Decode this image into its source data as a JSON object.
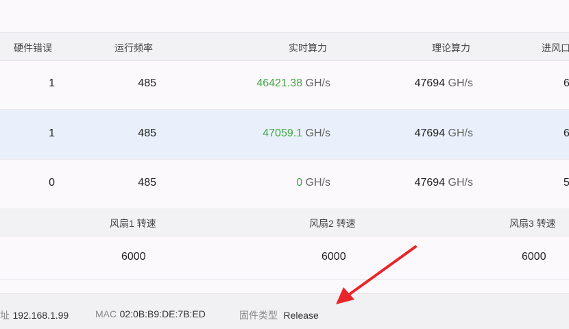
{
  "hash_table": {
    "headers": {
      "hw_errors": "硬件错误",
      "frequency": "运行频率",
      "realtime_hashrate": "实时算力",
      "theoretical_hashrate": "理论算力",
      "inlet": "进风口"
    },
    "rows": [
      {
        "hw_errors": "1",
        "frequency": "485",
        "realtime_value": "46421.38",
        "realtime_unit": "GH/s",
        "theoretical_value": "47694",
        "theoretical_unit": "GH/s",
        "inlet": "6"
      },
      {
        "hw_errors": "1",
        "frequency": "485",
        "realtime_value": "47059.1",
        "realtime_unit": "GH/s",
        "theoretical_value": "47694",
        "theoretical_unit": "GH/s",
        "inlet": "6"
      },
      {
        "hw_errors": "0",
        "frequency": "485",
        "realtime_value": "0",
        "realtime_unit": "GH/s",
        "theoretical_value": "47694",
        "theoretical_unit": "GH/s",
        "inlet": "5"
      }
    ]
  },
  "fan_table": {
    "headers": {
      "fan1": "风扇1 转速",
      "fan2": "风扇2 转速",
      "fan3": "风扇3 转速"
    },
    "values": {
      "fan1": "6000",
      "fan2": "6000",
      "fan3": "6000"
    }
  },
  "footer": {
    "ip_label": "址",
    "ip_value": "192.168.1.99",
    "mac_label": "MAC",
    "mac_value": "02:0B:B9:DE:7B:ED",
    "firmware_label": "固件类型",
    "firmware_value": "Release"
  },
  "colors": {
    "hashrate_green": "#3fa63f",
    "annotation_arrow": "#e8262a",
    "alt_row": "#e9f0fb"
  }
}
